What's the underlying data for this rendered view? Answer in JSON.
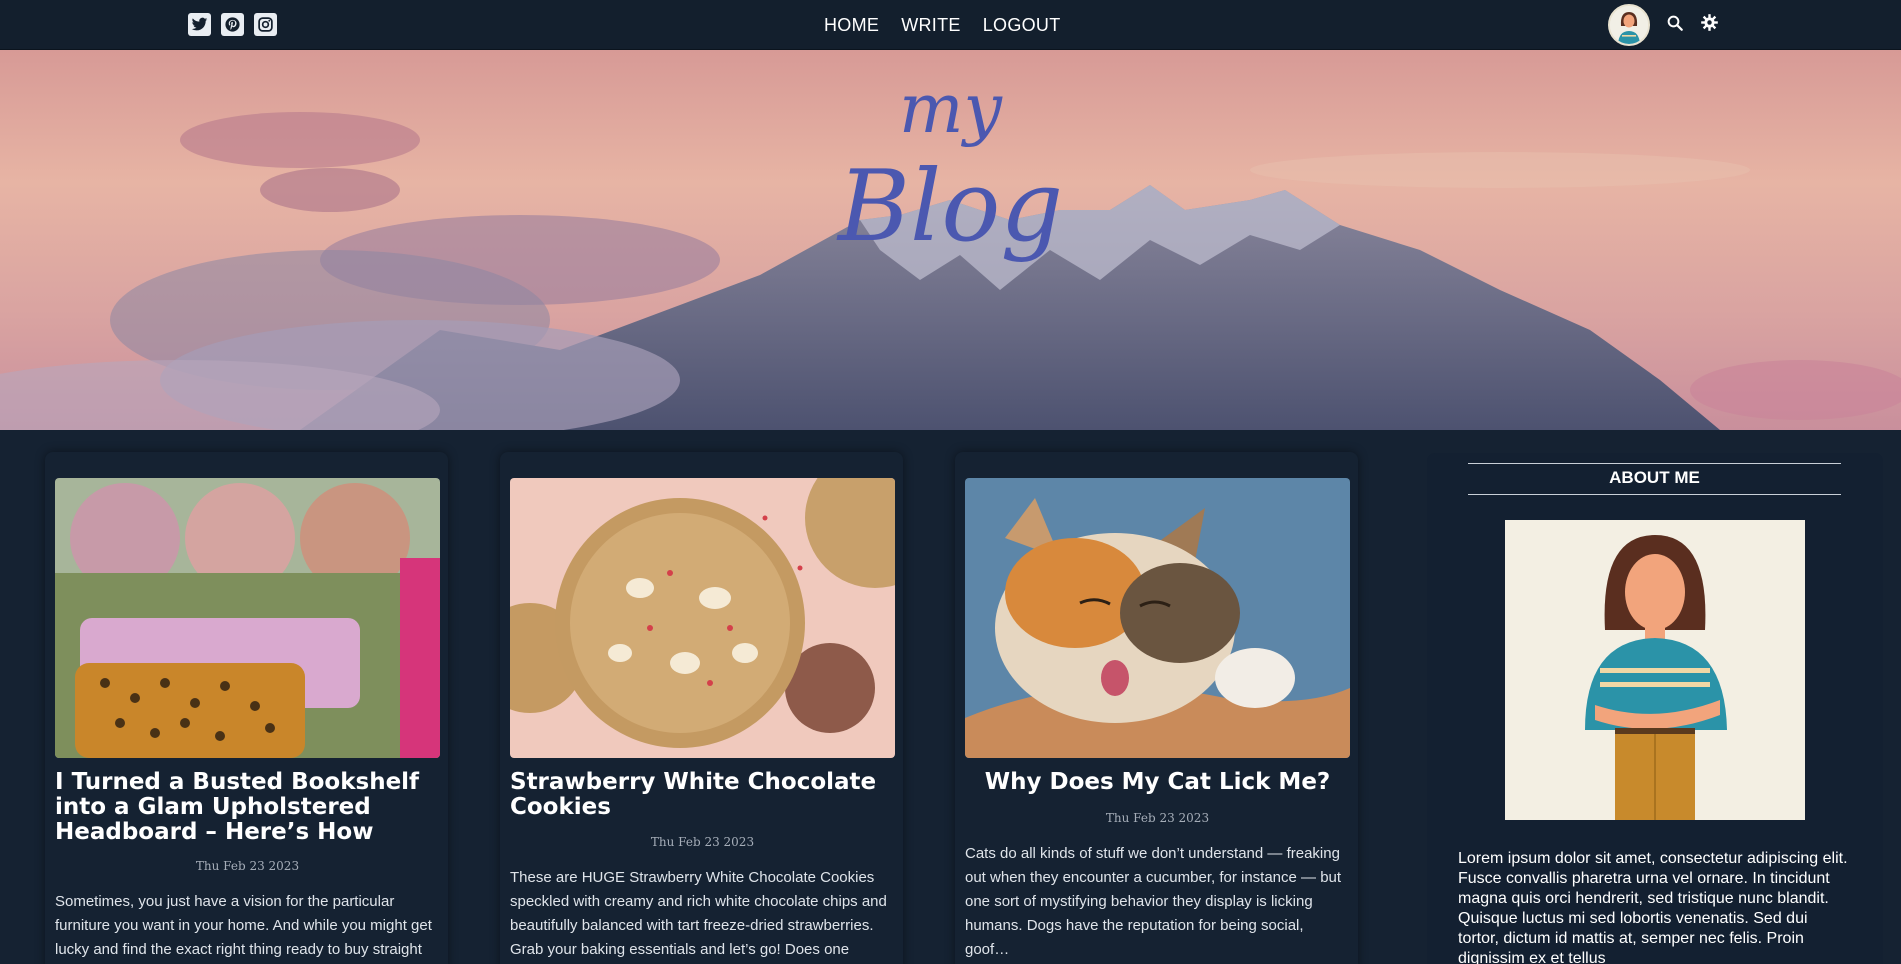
{
  "nav": {
    "social": [
      "twitter-icon",
      "pinterest-icon",
      "instagram-icon"
    ],
    "links": [
      "HOME",
      "WRITE",
      "LOGOUT"
    ],
    "right_icons": [
      "avatar",
      "search-icon",
      "gear-icon"
    ]
  },
  "hero": {
    "line1": "my",
    "line2": "Blog"
  },
  "posts": [
    {
      "title": "I Turned a Busted Bookshelf into a Glam Upholstered Headboard – Here’s How",
      "date": "Thu Feb 23 2023",
      "excerpt": "Sometimes, you just have a vision for the particular furniture you want in your home. And while you might get lucky and find the exact right thing ready to buy straight"
    },
    {
      "title": "Strawberry White Chocolate Cookies",
      "date": "Thu Feb 23 2023",
      "excerpt": "These are HUGE Strawberry White Chocolate Cookies speckled with creamy and rich white chocolate chips and beautifully balanced with tart freeze-dried strawberries. Grab your baking essentials and let’s go! Does one ever…"
    },
    {
      "title": "Why Does My Cat Lick Me?",
      "date": "Thu Feb 23 2023",
      "excerpt": "Cats do all kinds of stuff we don’t understand — freaking out when they encounter a cucumber, for instance — but one sort of mystifying behavior they display is licking humans. Dogs have the reputation for being social, goof…"
    }
  ],
  "about": {
    "heading": "ABOUT ME",
    "bio": "Lorem ipsum dolor sit amet, consectetur adipiscing elit. Fusce convallis pharetra urna vel ornare. In tincidunt magna quis orci hendrerit, sed tristique nunc blandit. Quisque luctus mi sed lobortis venenatis. Sed dui tortor, dictum id mattis at, semper nec felis. Proin dignissim ex et tellus"
  }
}
